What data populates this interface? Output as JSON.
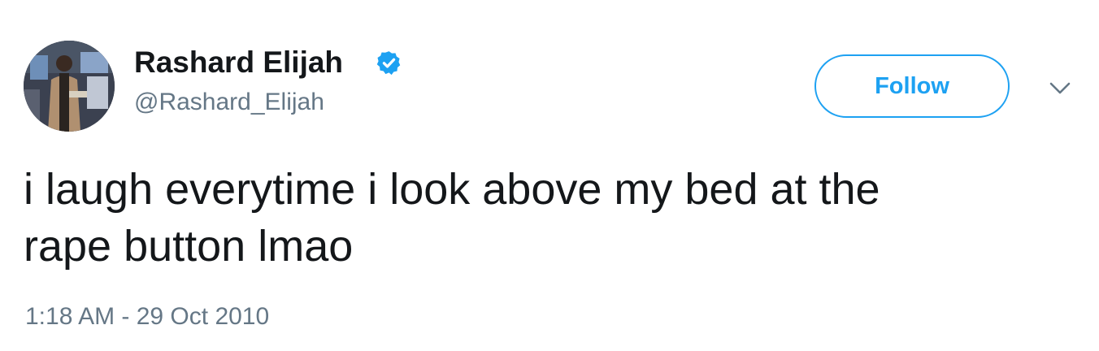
{
  "user": {
    "display_name": "Rashard Elijah",
    "handle": "@Rashard_Elijah",
    "verified": true,
    "avatar": "profile-photo"
  },
  "actions": {
    "follow_label": "Follow",
    "more_icon": "chevron-down-icon"
  },
  "tweet": {
    "text_line1": "i laugh everytime i look above my bed at the",
    "text_line2": "rape button lmao",
    "timestamp": "1:18 AM - 29 Oct 2010"
  },
  "colors": {
    "accent": "#1da1f2",
    "text": "#14171a",
    "secondary_text": "#657786"
  }
}
